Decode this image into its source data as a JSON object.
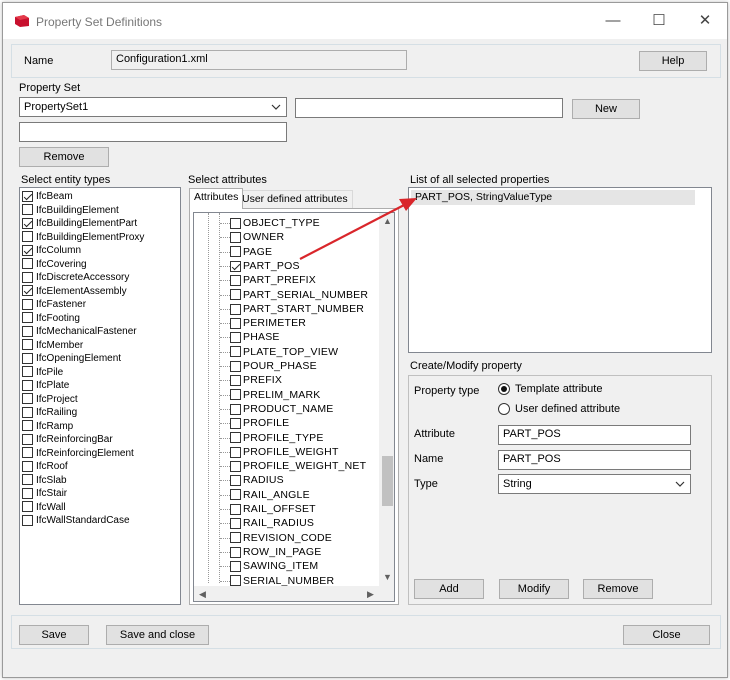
{
  "window": {
    "title": "Property Set Definitions",
    "minimize": "—",
    "maximize": "☐",
    "close": "✕"
  },
  "top": {
    "name_label": "Name",
    "name_value": "Configuration1.xml",
    "help_label": "Help"
  },
  "property_set": {
    "label": "Property Set",
    "selected": "PropertySet1",
    "name_input": "",
    "new_label": "New",
    "extra_input": "",
    "remove_label": "Remove"
  },
  "entity_types": {
    "label": "Select entity types",
    "items": [
      {
        "name": "IfcBeam",
        "checked": true
      },
      {
        "name": "IfcBuildingElement",
        "checked": false
      },
      {
        "name": "IfcBuildingElementPart",
        "checked": true
      },
      {
        "name": "IfcBuildingElementProxy",
        "checked": false
      },
      {
        "name": "IfcColumn",
        "checked": true
      },
      {
        "name": "IfcCovering",
        "checked": false
      },
      {
        "name": "IfcDiscreteAccessory",
        "checked": false
      },
      {
        "name": "IfcElementAssembly",
        "checked": true
      },
      {
        "name": "IfcFastener",
        "checked": false
      },
      {
        "name": "IfcFooting",
        "checked": false
      },
      {
        "name": "IfcMechanicalFastener",
        "checked": false
      },
      {
        "name": "IfcMember",
        "checked": false
      },
      {
        "name": "IfcOpeningElement",
        "checked": false
      },
      {
        "name": "IfcPile",
        "checked": false
      },
      {
        "name": "IfcPlate",
        "checked": false
      },
      {
        "name": "IfcProject",
        "checked": false
      },
      {
        "name": "IfcRailing",
        "checked": false
      },
      {
        "name": "IfcRamp",
        "checked": false
      },
      {
        "name": "IfcReinforcingBar",
        "checked": false
      },
      {
        "name": "IfcReinforcingElement",
        "checked": false
      },
      {
        "name": "IfcRoof",
        "checked": false
      },
      {
        "name": "IfcSlab",
        "checked": false
      },
      {
        "name": "IfcStair",
        "checked": false
      },
      {
        "name": "IfcWall",
        "checked": false
      },
      {
        "name": "IfcWallStandardCase",
        "checked": false
      }
    ]
  },
  "attributes": {
    "label": "Select attributes",
    "tabs": [
      "Attributes",
      "User defined attributes"
    ],
    "items": [
      {
        "name": "OBJECT_TYPE",
        "checked": false
      },
      {
        "name": "OWNER",
        "checked": false
      },
      {
        "name": "PAGE",
        "checked": false
      },
      {
        "name": "PART_POS",
        "checked": true
      },
      {
        "name": "PART_PREFIX",
        "checked": false
      },
      {
        "name": "PART_SERIAL_NUMBER",
        "checked": false
      },
      {
        "name": "PART_START_NUMBER",
        "checked": false
      },
      {
        "name": "PERIMETER",
        "checked": false
      },
      {
        "name": "PHASE",
        "checked": false
      },
      {
        "name": "PLATE_TOP_VIEW",
        "checked": false
      },
      {
        "name": "POUR_PHASE",
        "checked": false
      },
      {
        "name": "PREFIX",
        "checked": false
      },
      {
        "name": "PRELIM_MARK",
        "checked": false
      },
      {
        "name": "PRODUCT_NAME",
        "checked": false
      },
      {
        "name": "PROFILE",
        "checked": false
      },
      {
        "name": "PROFILE_TYPE",
        "checked": false
      },
      {
        "name": "PROFILE_WEIGHT",
        "checked": false
      },
      {
        "name": "PROFILE_WEIGHT_NET",
        "checked": false
      },
      {
        "name": "RADIUS",
        "checked": false
      },
      {
        "name": "RAIL_ANGLE",
        "checked": false
      },
      {
        "name": "RAIL_OFFSET",
        "checked": false
      },
      {
        "name": "RAIL_RADIUS",
        "checked": false
      },
      {
        "name": "REVISION_CODE",
        "checked": false
      },
      {
        "name": "ROW_IN_PAGE",
        "checked": false
      },
      {
        "name": "SAWING_ITEM",
        "checked": false
      },
      {
        "name": "SERIAL_NUMBER",
        "checked": false
      }
    ]
  },
  "selected_properties": {
    "label": "List of all selected properties",
    "items": [
      {
        "text": "PART_POS,  StringValueType"
      }
    ]
  },
  "modify": {
    "label": "Create/Modify property",
    "property_type_label": "Property type",
    "template_label": "Template attribute",
    "user_defined_label": "User defined attribute",
    "attribute_label": "Attribute",
    "attribute_value": "PART_POS",
    "name_label": "Name",
    "name_value": "PART_POS",
    "type_label": "Type",
    "type_value": "String",
    "add_label": "Add",
    "modify_label": "Modify",
    "remove_label": "Remove"
  },
  "footer": {
    "save_label": "Save",
    "save_close_label": "Save and close",
    "close_label": "Close"
  },
  "colors": {
    "annotation_arrow": "#d9262b",
    "selection": "#e5e5e5"
  }
}
